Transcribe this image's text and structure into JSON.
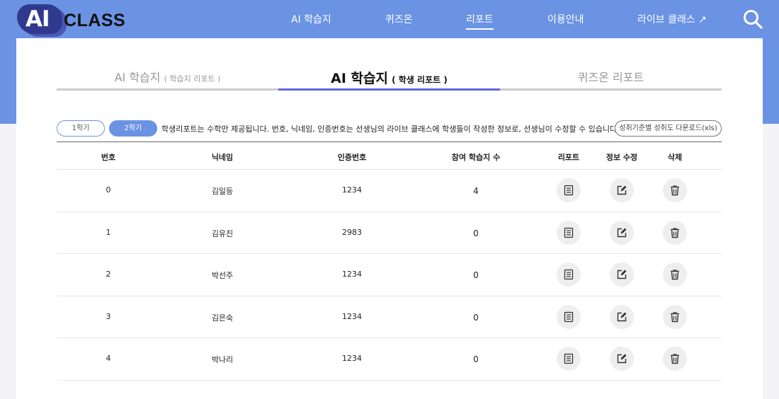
{
  "header": {
    "logo_ai": "AI",
    "logo_class": "CLASS",
    "nav": [
      {
        "label": "AI 학습지",
        "active": false
      },
      {
        "label": "퀴즈온",
        "active": false
      },
      {
        "label": "리포트",
        "active": true
      },
      {
        "label": "이용안내",
        "active": false
      },
      {
        "label": "라이브 클래스 ↗",
        "active": false
      }
    ],
    "search_icon": "search-icon"
  },
  "tabs": [
    {
      "main": "AI 학습지",
      "sub": "( 학습지 리포트 )",
      "active": false
    },
    {
      "main": "AI 학습지",
      "sub": "( 학생 리포트 )",
      "active": true
    },
    {
      "main": "퀴즈온 리포트",
      "sub": "",
      "active": false
    }
  ],
  "semesters": [
    {
      "label": "1학기",
      "active": false
    },
    {
      "label": "2학기",
      "active": true
    }
  ],
  "info_text": "학생리포트는 수학만 제공됩니다. 번호, 닉네임, 인증번호는 선생님의 라이브 클래스에 학생들이 작성한 정보로, 선생님이 수정할 수 있습니다.",
  "download_label": "성취기준별 성취도 다운로드(xls)",
  "table": {
    "headers": [
      "번호",
      "닉네임",
      "인증번호",
      "참여 학습지 수",
      "리포트",
      "정보 수정",
      "삭제"
    ],
    "rows": [
      {
        "num": "0",
        "nickname": "김일등",
        "code": "1234",
        "count": "4"
      },
      {
        "num": "1",
        "nickname": "김유진",
        "code": "2983",
        "count": "0"
      },
      {
        "num": "2",
        "nickname": "박선주",
        "code": "1234",
        "count": "0"
      },
      {
        "num": "3",
        "nickname": "김은숙",
        "code": "1234",
        "count": "0"
      },
      {
        "num": "4",
        "nickname": "박나리",
        "code": "1234",
        "count": "0"
      }
    ]
  },
  "colors": {
    "brand": "#6b93e3",
    "active_tab": "#6068d8"
  }
}
